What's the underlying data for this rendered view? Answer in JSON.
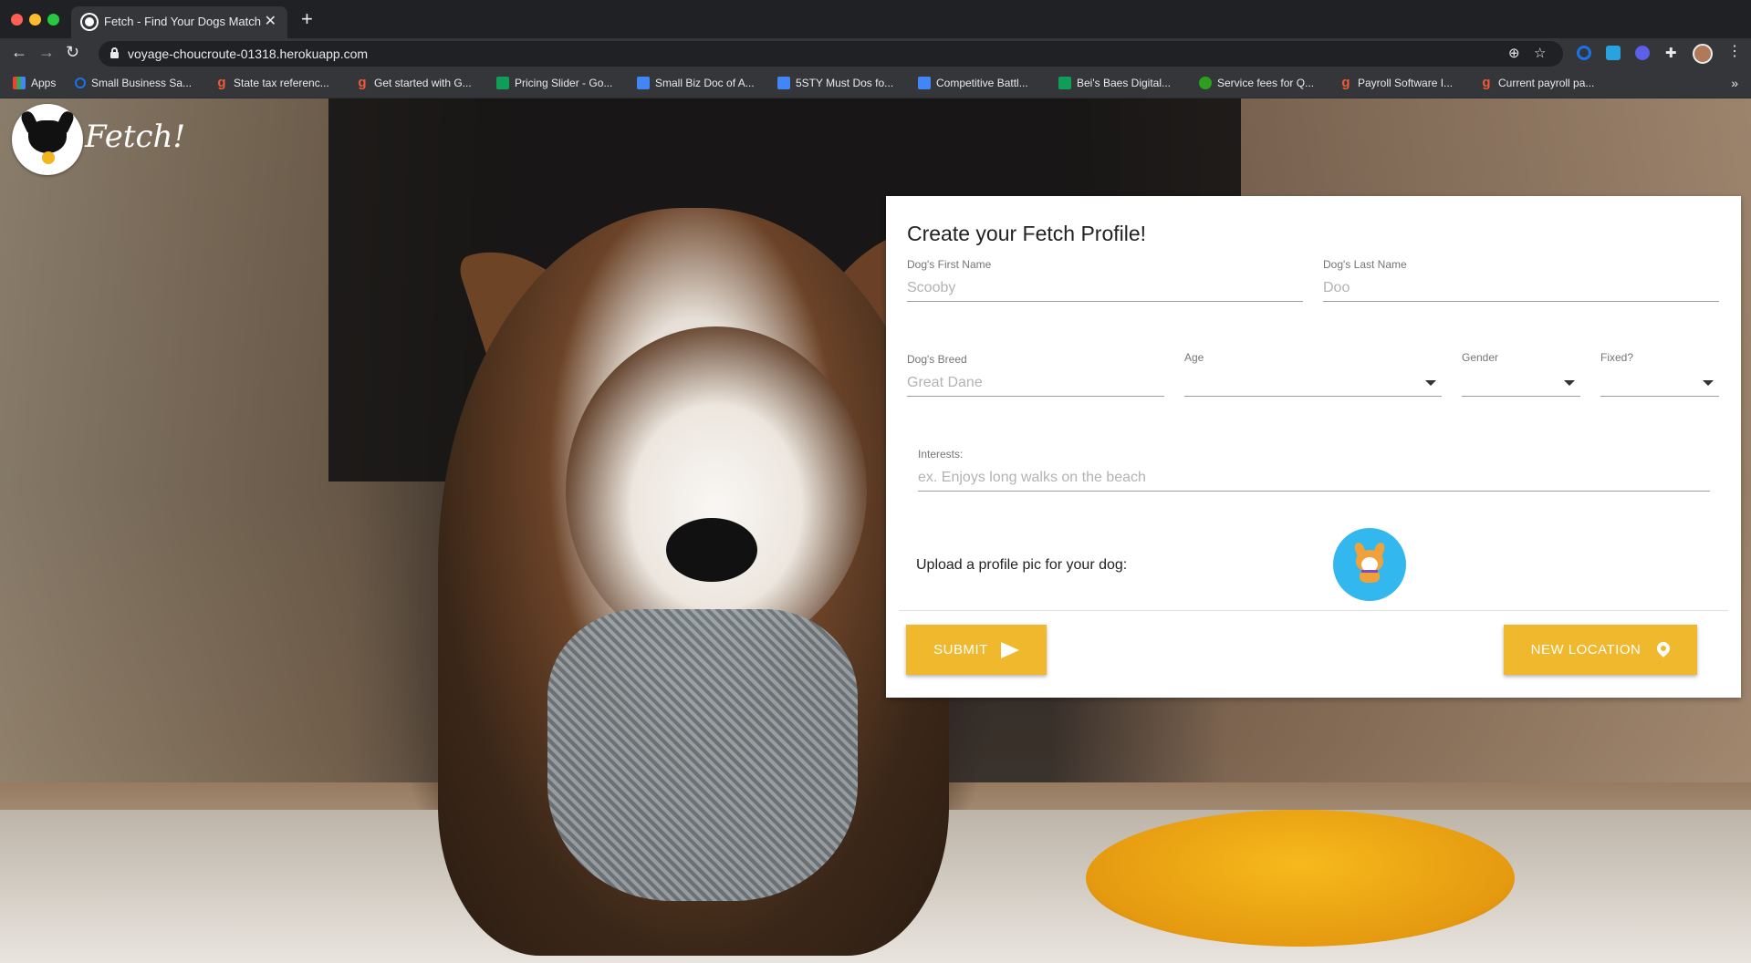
{
  "browser": {
    "tab_title": "Fetch - Find Your Dogs Match",
    "url": "voyage-choucroute-01318.herokuapp.com",
    "bookmarks": [
      {
        "label": "Apps",
        "icon": "apps-icon"
      },
      {
        "label": "Small Business Sa...",
        "icon": "circle-icon"
      },
      {
        "label": "State tax referenc...",
        "icon": "g-icon"
      },
      {
        "label": "Get started with G...",
        "icon": "g-icon"
      },
      {
        "label": "Pricing Slider - Go...",
        "icon": "sheets-icon"
      },
      {
        "label": "Small Biz Doc of A...",
        "icon": "docs-icon"
      },
      {
        "label": "5STY Must Dos fo...",
        "icon": "docs-icon"
      },
      {
        "label": "Competitive Battl...",
        "icon": "docs-icon"
      },
      {
        "label": "Bei's Baes Digital...",
        "icon": "sheets-icon"
      },
      {
        "label": "Service fees for Q...",
        "icon": "quickbooks-icon"
      },
      {
        "label": "Payroll Software I...",
        "icon": "g-icon"
      },
      {
        "label": "Current payroll pa...",
        "icon": "g-icon"
      }
    ]
  },
  "brand": {
    "name": "Fetch!"
  },
  "form": {
    "title": "Create your Fetch Profile!",
    "first_name": {
      "label": "Dog's First Name",
      "placeholder": "Scooby"
    },
    "last_name": {
      "label": "Dog's Last Name",
      "placeholder": "Doo"
    },
    "breed": {
      "label": "Dog's Breed",
      "placeholder": "Great Dane"
    },
    "age": {
      "label": "Age",
      "value": ""
    },
    "gender": {
      "label": "Gender",
      "value": ""
    },
    "fixed": {
      "label": "Fixed?",
      "value": ""
    },
    "interests": {
      "label": "Interests:",
      "placeholder": "ex. Enjoys long walks on the beach"
    },
    "upload_label": "Upload a profile pic for your dog:",
    "submit_label": "SUBMIT",
    "new_location_label": "NEW LOCATION"
  },
  "colors": {
    "accent": "#f0b82c",
    "upload_circle": "#33b7ef",
    "chrome_dark": "#202124",
    "chrome": "#35363a"
  }
}
